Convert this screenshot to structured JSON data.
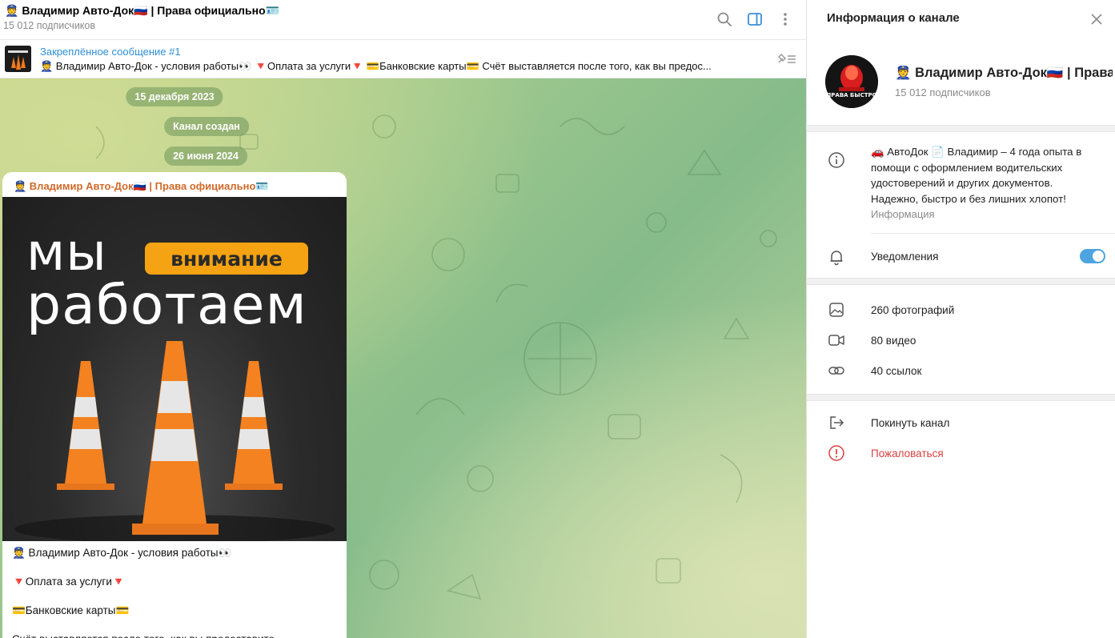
{
  "chat": {
    "title": "👮 Владимир Авто-Док🇷🇺 | Права официально🪪",
    "subscribers": "15 012 подписчиков"
  },
  "pinned": {
    "title": "Закреплённое сообщение #1",
    "preview": "👮 Владимир Авто-Док - условия работы👀   🔻Оплата за услуги🔻   💳Банковские карты💳      Счёт выставляется после того, как вы предос..."
  },
  "dates": {
    "first": "15 декабря 2023",
    "service": "Канал создан",
    "second": "26 июня 2024"
  },
  "message": {
    "author": "👮 Владимир Авто-Док🇷🇺 | Права официально🪪",
    "image_line1": "мы",
    "image_badge": "внимание",
    "image_line2": "работаем",
    "lines": [
      "👮 Владимир Авто-Док - условия работы👀",
      "🔻Оплата за услуги🔻",
      "💳Банковские карты💳",
      "Счёт выставляется после того, как вы предоставите"
    ]
  },
  "panel": {
    "title": "Информация о канале",
    "name": "👮 Владимир Авто-Док🇷🇺 | Права официально🪪",
    "subscribers": "15 012 подписчиков",
    "avatar_text": "ПРАВА БЫСТРО",
    "description": "🚗 АвтоДок 📄 Владимир – 4 года опыта в помощи с оформлением водительских удостоверений и других документов. Надежно, быстро и без лишних хлопот!",
    "description_caption": "Информация",
    "notifications_label": "Уведомления",
    "notifications_on": true,
    "media": {
      "photos": "260 фотографий",
      "videos": "80 видео",
      "links": "40 ссылок"
    },
    "leave_label": "Покинуть канал",
    "report_label": "Пожаловаться"
  },
  "colors": {
    "accent": "#4ea4e0",
    "author": "#d06a2a",
    "danger": "#d94040",
    "badge": "#f5a312"
  },
  "icons": {
    "search": "search-icon",
    "sidebar": "sidebar-toggle-icon",
    "more": "more-vertical-icon",
    "unpin": "unpin-icon",
    "close": "close-icon",
    "info": "info-icon",
    "bell": "bell-icon",
    "photo": "photo-icon",
    "video": "video-icon",
    "link": "link-icon",
    "leave": "leave-icon",
    "report": "report-icon"
  }
}
